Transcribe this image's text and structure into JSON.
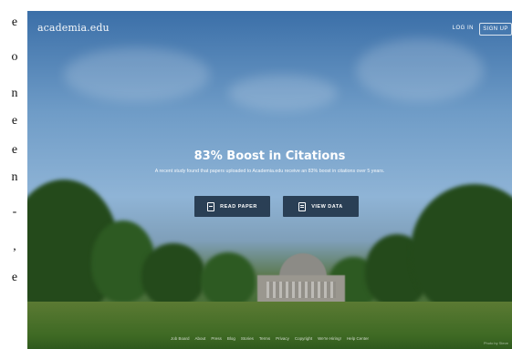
{
  "left_text_fragments": [
    "e",
    "o",
    "n",
    "e",
    "e",
    "n",
    "-",
    ",",
    "e"
  ],
  "header": {
    "logo": "academia.edu",
    "login_label": "LOG IN",
    "signup_label": "SIGN UP"
  },
  "hero": {
    "title": "83% Boost in Citations",
    "subtitle": "A recent study found that papers uploaded to Academia.edu receive an 83% boost in citations over 5 years.",
    "read_button": "READ PAPER",
    "view_button": "VIEW DATA"
  },
  "footer": {
    "links": [
      "Job Board",
      "About",
      "Press",
      "Blog",
      "Stories",
      "Terms",
      "Privacy",
      "Copyright",
      "We're Hiring!",
      "Help Center"
    ],
    "photo_credit": "Photo by Steve"
  },
  "colors": {
    "button_bg": "#2a3f55",
    "text": "#ffffff"
  }
}
